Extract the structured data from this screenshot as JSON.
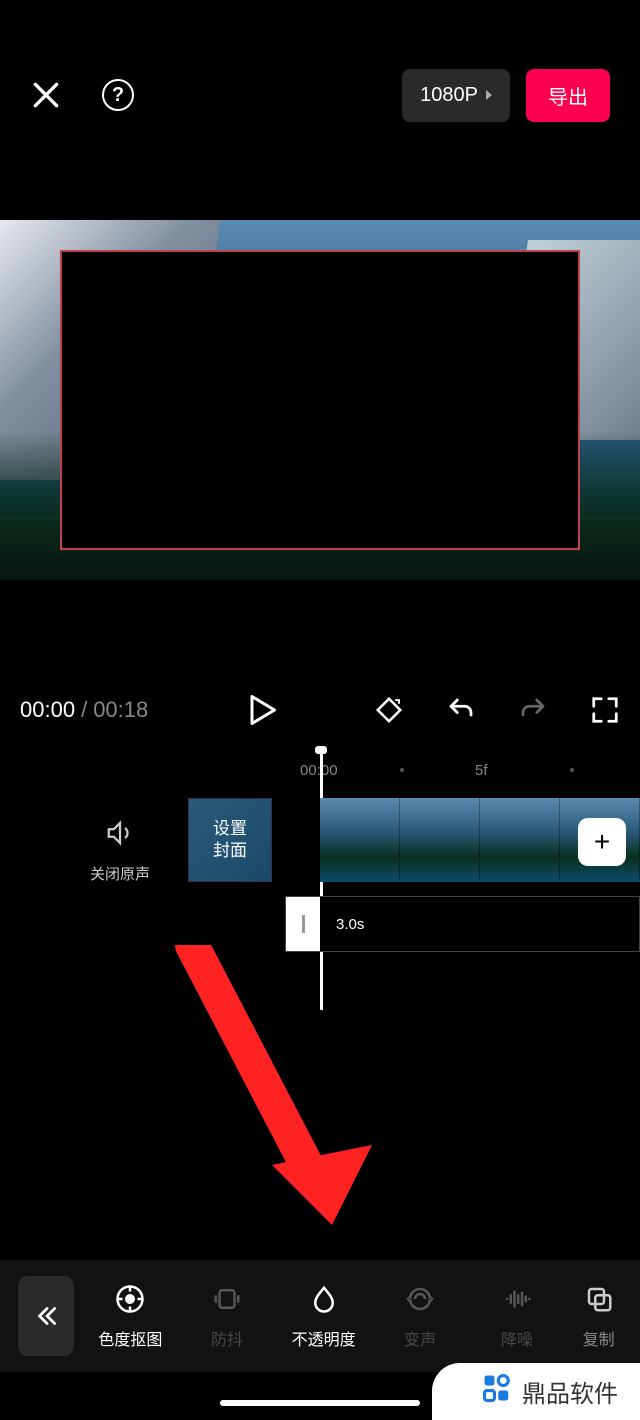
{
  "header": {
    "resolution": "1080P",
    "export": "导出"
  },
  "time": {
    "current": "00:00",
    "total": "00:18"
  },
  "ruler": {
    "t1": "00:00",
    "t2": "5f"
  },
  "tracks": {
    "mute": "关闭原声",
    "cover": "设置\n封面",
    "audio_duration": "3.0s"
  },
  "tools": {
    "back": "«",
    "items": [
      {
        "id": "chroma",
        "label": "色度抠图",
        "active": true,
        "dim": false
      },
      {
        "id": "stabilize",
        "label": "防抖",
        "active": false,
        "dim": true
      },
      {
        "id": "opacity",
        "label": "不透明度",
        "active": true,
        "dim": false
      },
      {
        "id": "voice",
        "label": "变声",
        "active": false,
        "dim": true
      },
      {
        "id": "denoise",
        "label": "降噪",
        "active": false,
        "dim": true
      },
      {
        "id": "copy",
        "label": "复制",
        "active": false,
        "dim": false
      }
    ]
  },
  "watermark": "鼎品软件"
}
